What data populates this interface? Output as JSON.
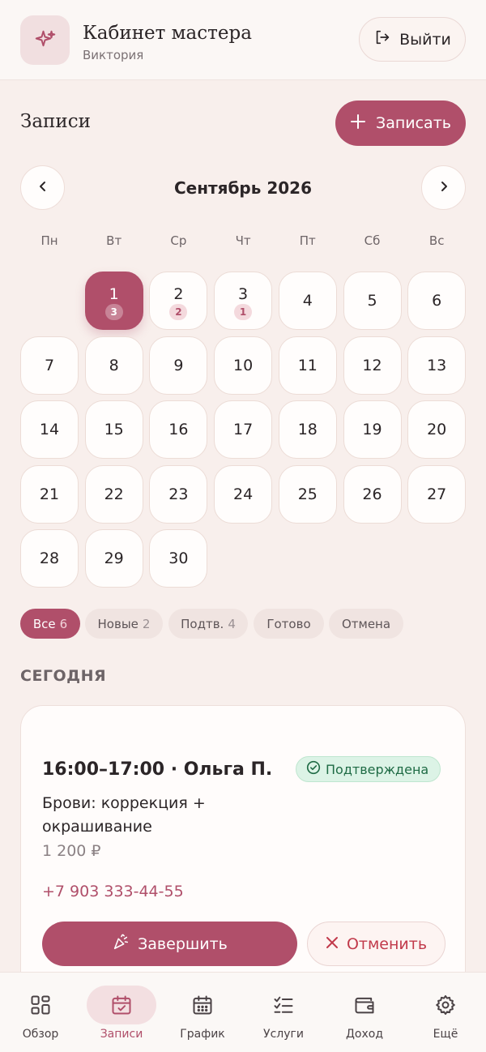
{
  "header": {
    "title": "Кабинет мастера",
    "subtitle": "Виктория",
    "logout_label": "Выйти"
  },
  "section": {
    "title": "Записи",
    "add_label": "Записать"
  },
  "calendar": {
    "month": "Сентябрь 2026",
    "weekdays": [
      "Пн",
      "Вт",
      "Ср",
      "Чт",
      "Пт",
      "Сб",
      "Вс"
    ],
    "selected_day": "1",
    "days": [
      {
        "n": "1",
        "count": "3"
      },
      {
        "n": "2",
        "count": "2"
      },
      {
        "n": "3",
        "count": "1"
      },
      {
        "n": "4"
      },
      {
        "n": "5"
      },
      {
        "n": "6"
      },
      {
        "n": "7"
      },
      {
        "n": "8"
      },
      {
        "n": "9"
      },
      {
        "n": "10"
      },
      {
        "n": "11"
      },
      {
        "n": "12"
      },
      {
        "n": "13"
      },
      {
        "n": "14"
      },
      {
        "n": "15"
      },
      {
        "n": "16"
      },
      {
        "n": "17"
      },
      {
        "n": "18"
      },
      {
        "n": "19"
      },
      {
        "n": "20"
      },
      {
        "n": "21"
      },
      {
        "n": "22"
      },
      {
        "n": "23"
      },
      {
        "n": "24"
      },
      {
        "n": "25"
      },
      {
        "n": "26"
      },
      {
        "n": "27"
      },
      {
        "n": "28"
      },
      {
        "n": "29"
      },
      {
        "n": "30"
      }
    ]
  },
  "filters": [
    {
      "label": "Все",
      "count": "6",
      "active": true
    },
    {
      "label": "Новые",
      "count": "2"
    },
    {
      "label": "Подтв.",
      "count": "4"
    },
    {
      "label": "Готово",
      "count": ""
    },
    {
      "label": "Отмена",
      "count": ""
    }
  ],
  "today": {
    "label": "СЕГОДНЯ",
    "appointment": {
      "time_client": "16:00–17:00 · Ольга П.",
      "status": "Подтверждена",
      "service": "Брови: коррекция + окрашивание",
      "price": "1 200 ₽",
      "phone": "+7 903 333-44-55",
      "finish_label": "Завершить",
      "cancel_label": "Отменить"
    }
  },
  "bottom_nav": [
    {
      "label": "Обзор",
      "icon": "grid-icon"
    },
    {
      "label": "Записи",
      "icon": "calendar-check-icon",
      "active": true
    },
    {
      "label": "График",
      "icon": "calendar-grid-icon"
    },
    {
      "label": "Услуги",
      "icon": "checklist-icon"
    },
    {
      "label": "Доход",
      "icon": "wallet-icon"
    },
    {
      "label": "Ещё",
      "icon": "gear-icon"
    }
  ],
  "colors": {
    "accent": "#b04f6a",
    "background": "#f8efec",
    "status_confirmed": "#1f6b45",
    "danger": "#c13a4b"
  }
}
